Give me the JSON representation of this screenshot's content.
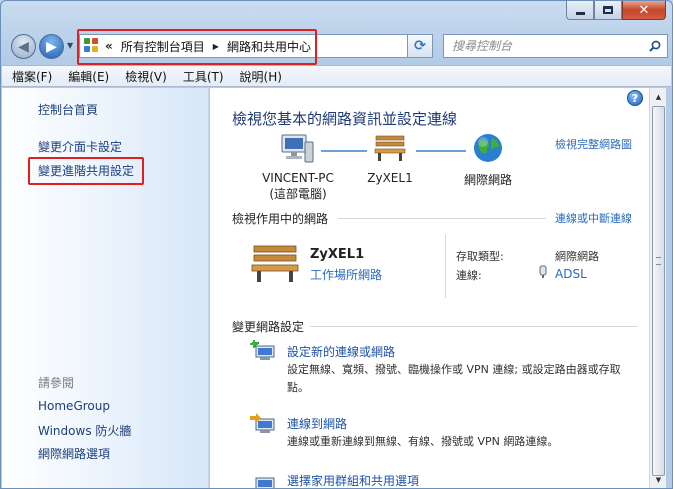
{
  "colors": {
    "link": "#2a6bbd",
    "title": "#1f3b77",
    "highlight": "#e02020",
    "sidebar_gradient_end": "#d7e6f8"
  },
  "window": {
    "minimize_icon": "minimize-icon",
    "maximize_icon": "maximize-icon",
    "close_icon": "close-icon",
    "close_glyph": "✕"
  },
  "navigation": {
    "back_glyph": "◀",
    "forward_glyph": "▶",
    "history_glyph": "▼",
    "address_chevrons": "«",
    "breadcrumbs": [
      "所有控制台項目",
      "網路和共用中心"
    ],
    "crumb_separator": "▶",
    "dropdown_glyph": "▼",
    "refresh_glyph": "⟳",
    "search_placeholder": "搜尋控制台"
  },
  "menu": [
    "檔案(F)",
    "編輯(E)",
    "檢視(V)",
    "工具(T)",
    "說明(H)"
  ],
  "sidebar": {
    "links": [
      "控制台首頁",
      "變更介面卡設定",
      "變更進階共用設定"
    ],
    "see_also_heading": "請參閱",
    "see_also": [
      "HomeGroup",
      "Windows 防火牆",
      "網際網路選項"
    ]
  },
  "content": {
    "help_glyph": "?",
    "title": "檢視您基本的網路資訊並設定連線",
    "full_map_link": "檢視完整網路圖",
    "map_nodes": [
      {
        "label": "VINCENT-PC",
        "sublabel": "(這部電腦)",
        "icon": "computer-icon"
      },
      {
        "label": "ZyXEL1",
        "sublabel": "",
        "icon": "bench-icon"
      },
      {
        "label": "網際網路",
        "sublabel": "",
        "icon": "globe-icon"
      }
    ],
    "active_networks": {
      "heading": "檢視作用中的網路",
      "connect_link": "連線或中斷連線",
      "network_name": "ZyXEL1",
      "network_type": "工作場所網路",
      "access_type_label": "存取類型:",
      "access_type_value": "網際網路",
      "connection_label": "連線:",
      "connection_value": "ADSL"
    },
    "change_settings": {
      "heading": "變更網路設定",
      "tasks": [
        {
          "title": "設定新的連線或網路",
          "desc": "設定無線、寬頻、撥號、臨機操作或 VPN 連線; 或設定路由器或存取點。"
        },
        {
          "title": "連線到網路",
          "desc": "連線或重新連線到無線、有線、撥號或 VPN 網路連線。"
        },
        {
          "title": "選擇家用群組和共用選項",
          "desc": ""
        }
      ]
    }
  },
  "scrollbar": {
    "up_glyph": "▲",
    "down_glyph": "▼"
  }
}
